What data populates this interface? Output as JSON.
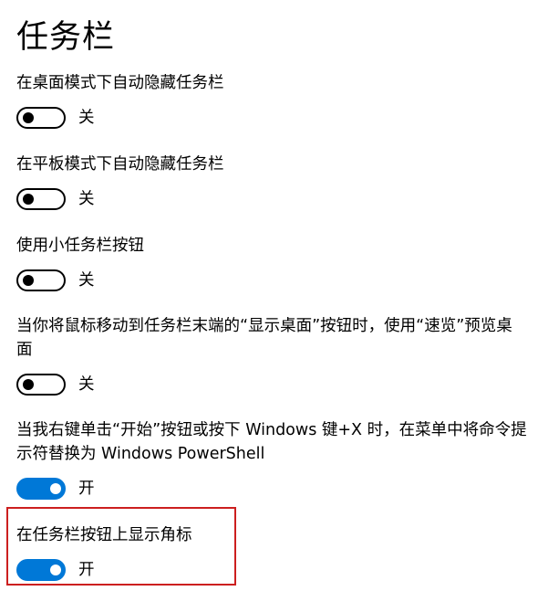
{
  "page": {
    "title": "任务栏"
  },
  "settings": [
    {
      "label": "在桌面模式下自动隐藏任务栏",
      "state": "关"
    },
    {
      "label": "在平板模式下自动隐藏任务栏",
      "state": "关"
    },
    {
      "label": "使用小任务栏按钮",
      "state": "关"
    },
    {
      "label": "当你将鼠标移动到任务栏末端的“显示桌面”按钮时，使用“速览”预览桌面",
      "state": "关"
    },
    {
      "label": "当我右键单击“开始”按钮或按下 Windows 键+X 时，在菜单中将命令提示符替换为 Windows PowerShell",
      "state": "开"
    },
    {
      "label": "在任务栏按钮上显示角标",
      "state": "开"
    }
  ],
  "toggle_values": [
    false,
    false,
    false,
    false,
    true,
    true
  ],
  "colors": {
    "accent": "#0078d7",
    "highlight_border": "#cc1f1f",
    "text": "#000000",
    "background": "#ffffff"
  }
}
